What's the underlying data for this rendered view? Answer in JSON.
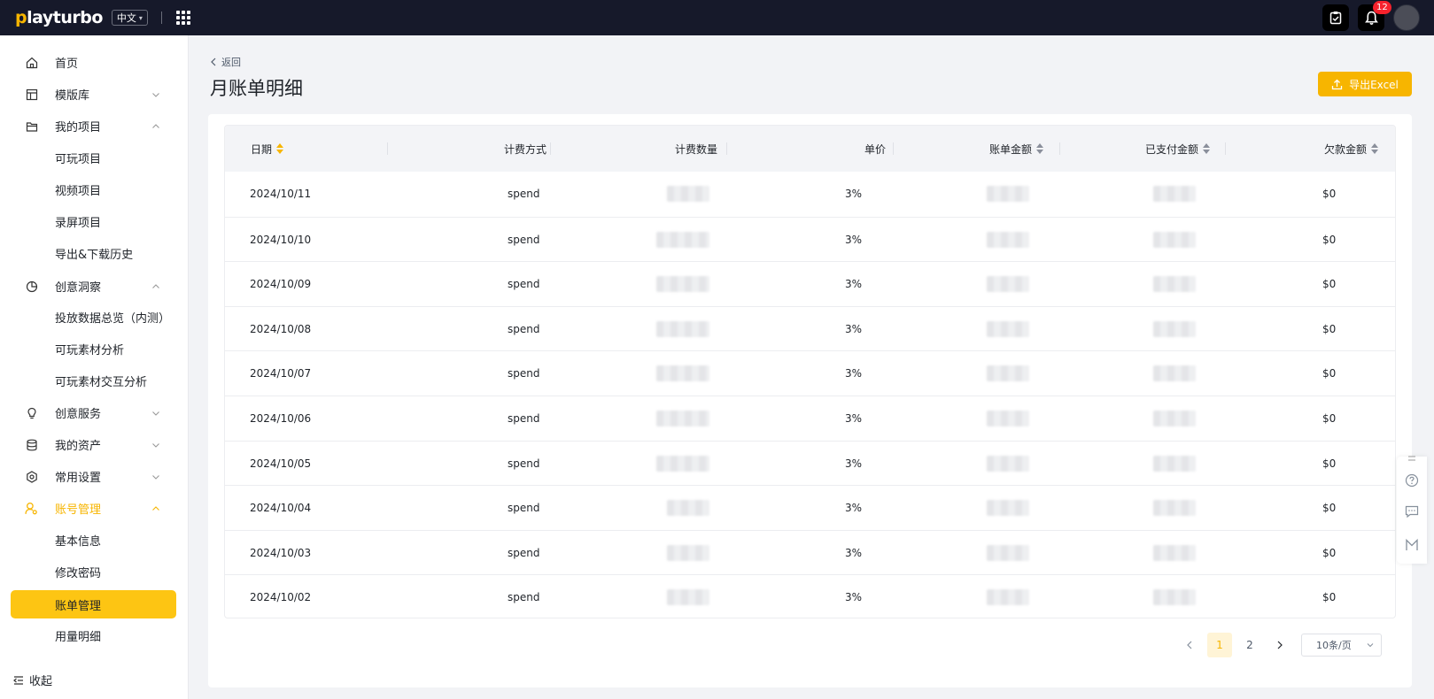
{
  "topbar": {
    "logo_prefix": "p",
    "logo_rest": "layturbo",
    "language": "中文",
    "notification_count": "12"
  },
  "sidebar": {
    "items": [
      {
        "label": "首页"
      },
      {
        "label": "模版库"
      },
      {
        "label": "我的项目"
      },
      {
        "label": "可玩项目"
      },
      {
        "label": "视频项目"
      },
      {
        "label": "录屏项目"
      },
      {
        "label": "导出&下载历史"
      },
      {
        "label": "创意洞察"
      },
      {
        "label": "投放数据总览（内测）"
      },
      {
        "label": "可玩素材分析"
      },
      {
        "label": "可玩素材交互分析"
      },
      {
        "label": "创意服务"
      },
      {
        "label": "我的资产"
      },
      {
        "label": "常用设置"
      },
      {
        "label": "账号管理"
      },
      {
        "label": "基本信息"
      },
      {
        "label": "修改密码"
      },
      {
        "label": "账单管理"
      },
      {
        "label": "用量明细"
      }
    ],
    "collapse_label": "收起"
  },
  "header": {
    "back_label": "返回",
    "title": "月账单明细",
    "export_label": "导出Excel"
  },
  "table": {
    "columns": [
      "日期",
      "计费方式",
      "计费数量",
      "单价",
      "账单金额",
      "已支付金额",
      "欠款金额"
    ],
    "rows": [
      {
        "date": "2024/10/11",
        "method": "spend",
        "price": "3%",
        "debt": "$0"
      },
      {
        "date": "2024/10/10",
        "method": "spend",
        "price": "3%",
        "debt": "$0"
      },
      {
        "date": "2024/10/09",
        "method": "spend",
        "price": "3%",
        "debt": "$0"
      },
      {
        "date": "2024/10/08",
        "method": "spend",
        "price": "3%",
        "debt": "$0"
      },
      {
        "date": "2024/10/07",
        "method": "spend",
        "price": "3%",
        "debt": "$0"
      },
      {
        "date": "2024/10/06",
        "method": "spend",
        "price": "3%",
        "debt": "$0"
      },
      {
        "date": "2024/10/05",
        "method": "spend",
        "price": "3%",
        "debt": "$0"
      },
      {
        "date": "2024/10/04",
        "method": "spend",
        "price": "3%",
        "debt": "$0"
      },
      {
        "date": "2024/10/03",
        "method": "spend",
        "price": "3%",
        "debt": "$0"
      },
      {
        "date": "2024/10/02",
        "method": "spend",
        "price": "3%",
        "debt": "$0"
      }
    ]
  },
  "pagination": {
    "pages": [
      "1",
      "2"
    ],
    "current": "1",
    "page_size": "10条/页"
  },
  "colors": {
    "accent": "#f7b500",
    "selected_bg": "#fdc513",
    "topbar_bg": "#16192a"
  }
}
